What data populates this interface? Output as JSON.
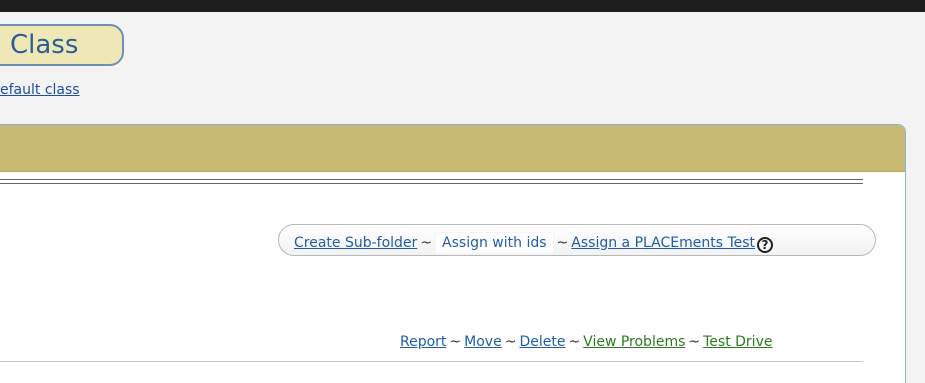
{
  "header": {
    "title": "Class",
    "default_link": "efault class"
  },
  "actions": {
    "create_subfolder": "Create Sub-folder",
    "assign_with_ids": "Assign with ids",
    "assign_placements": "Assign a PLACEments Test",
    "separator": "~",
    "help_icon": "question-circle-icon"
  },
  "bottom_actions": {
    "report": "Report",
    "move": "Move",
    "delete": "Delete",
    "view_problems": "View Problems",
    "test_drive": "Test Drive",
    "separator": "~"
  }
}
